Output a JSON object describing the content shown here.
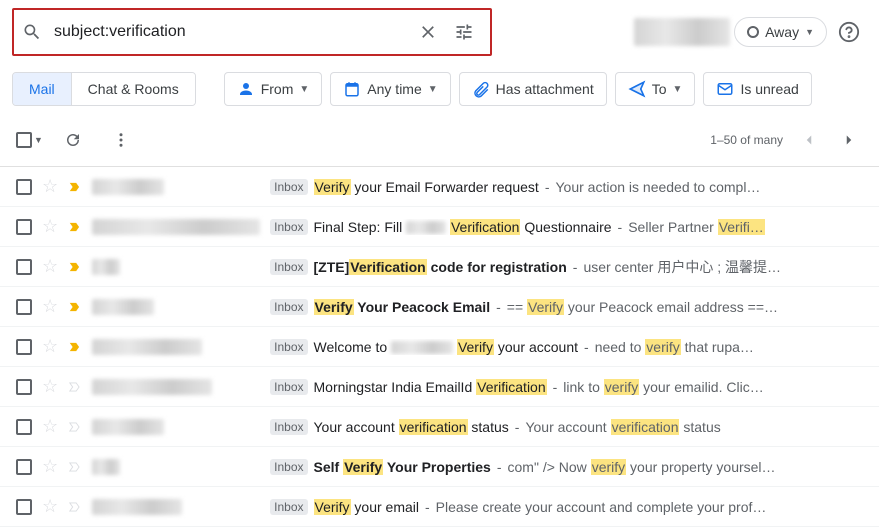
{
  "search": {
    "value": "subject:verification"
  },
  "status": {
    "away_label": "Away"
  },
  "tabs": {
    "mail": "Mail",
    "chat": "Chat & Rooms"
  },
  "chips": {
    "from": "From",
    "anytime": "Any time",
    "has_attachment": "Has attachment",
    "to": "To",
    "is_unread": "Is unread"
  },
  "pagination": {
    "range": "1–50 of many"
  },
  "labels": {
    "inbox": "Inbox"
  },
  "emails": [
    {
      "important": true,
      "bold": false,
      "sender_w": 72,
      "subject_parts": [
        {
          "t": "Verify",
          "hl": true
        },
        {
          "t": " your Email Forwarder request"
        }
      ],
      "snippet_parts": [
        {
          "t": "Your action is needed to compl…"
        }
      ]
    },
    {
      "important": true,
      "bold": false,
      "sender_w": 168,
      "subject_parts": [
        {
          "t": "Final Step: Fill "
        },
        {
          "t": "",
          "blur": true,
          "w": 40
        },
        {
          "t": " "
        },
        {
          "t": "Verification",
          "hl": true
        },
        {
          "t": " Questionnaire"
        }
      ],
      "snippet_parts": [
        {
          "t": "Seller Partner "
        },
        {
          "t": "Verifi…",
          "hl": true
        }
      ]
    },
    {
      "important": true,
      "bold": true,
      "sender_w": 28,
      "subject_parts": [
        {
          "t": "[ZTE]"
        },
        {
          "t": "Verification",
          "hl": true
        },
        {
          "t": " code for registration"
        }
      ],
      "snippet_parts": [
        {
          "t": "user center 用户中心 ; 温馨提…"
        }
      ]
    },
    {
      "important": true,
      "bold": true,
      "sender_w": 62,
      "subject_parts": [
        {
          "t": "Verify",
          "hl": true
        },
        {
          "t": " Your Peacock Email"
        }
      ],
      "snippet_parts": [
        {
          "t": "== "
        },
        {
          "t": "Verify",
          "hl": true
        },
        {
          "t": " your Peacock email address ==…"
        }
      ]
    },
    {
      "important": true,
      "bold": false,
      "sender_w": 110,
      "subject_parts": [
        {
          "t": "Welcome to "
        },
        {
          "t": "",
          "blur": true,
          "w": 62
        },
        {
          "t": " "
        },
        {
          "t": "Verify",
          "hl": true
        },
        {
          "t": " your account"
        }
      ],
      "snippet_parts": [
        {
          "t": "need to "
        },
        {
          "t": "verify",
          "hl": true
        },
        {
          "t": " that rupa…"
        }
      ]
    },
    {
      "important": false,
      "bold": false,
      "sender_w": 120,
      "subject_parts": [
        {
          "t": "Morningstar India EmailId "
        },
        {
          "t": "Verification",
          "hl": true
        }
      ],
      "snippet_parts": [
        {
          "t": "link to "
        },
        {
          "t": "verify",
          "hl": true
        },
        {
          "t": " your emailid. Clic…"
        }
      ]
    },
    {
      "important": false,
      "bold": false,
      "sender_w": 72,
      "subject_parts": [
        {
          "t": "Your account "
        },
        {
          "t": "verification",
          "hl": true
        },
        {
          "t": " status"
        }
      ],
      "snippet_parts": [
        {
          "t": "Your account "
        },
        {
          "t": "verification",
          "hl": true
        },
        {
          "t": " status"
        }
      ]
    },
    {
      "important": false,
      "bold": true,
      "sender_w": 28,
      "subject_parts": [
        {
          "t": "Self "
        },
        {
          "t": "Verify",
          "hl": true
        },
        {
          "t": " Your Properties"
        }
      ],
      "snippet_parts": [
        {
          "t": "com\" /> Now "
        },
        {
          "t": "verify",
          "hl": true
        },
        {
          "t": " your property yoursel…"
        }
      ]
    },
    {
      "important": false,
      "bold": false,
      "sender_w": 90,
      "subject_parts": [
        {
          "t": "Verify",
          "hl": true
        },
        {
          "t": " your email"
        }
      ],
      "snippet_parts": [
        {
          "t": "Please create your account and complete your prof…"
        }
      ]
    }
  ]
}
